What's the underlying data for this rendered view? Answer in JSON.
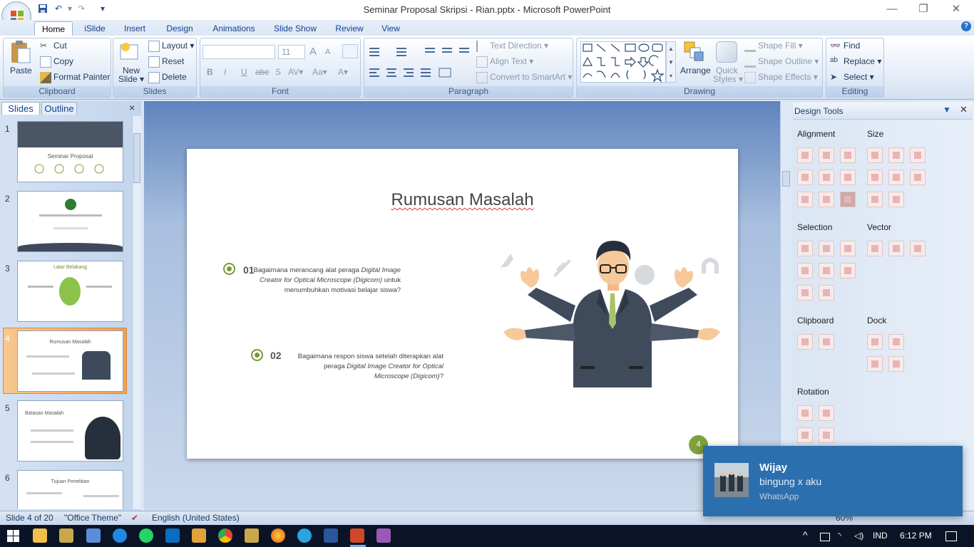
{
  "window": {
    "title": "Seminar Proposal Skripsi - Rian.pptx - Microsoft PowerPoint",
    "minimize": "—",
    "restore": "❐",
    "close": "✕"
  },
  "qat": {
    "save": "💾",
    "undo": "↶",
    "redo": "↷",
    "more": "▾"
  },
  "tabs": [
    {
      "label": "Home"
    },
    {
      "label": "iSlide"
    },
    {
      "label": "Insert"
    },
    {
      "label": "Design"
    },
    {
      "label": "Animations"
    },
    {
      "label": "Slide Show"
    },
    {
      "label": "Review"
    },
    {
      "label": "View"
    }
  ],
  "help": "?",
  "ribbon": {
    "clipboard": {
      "label": "Clipboard",
      "paste": "Paste",
      "cut": "Cut",
      "copy": "Copy",
      "format_painter": "Format Painter"
    },
    "slides": {
      "label": "Slides",
      "new_slide_1": "New",
      "new_slide_2": "Slide ▾",
      "layout": "Layout ▾",
      "reset": "Reset",
      "delete": "Delete"
    },
    "font": {
      "label": "Font",
      "size": "11",
      "bold": "B",
      "italic": "I",
      "underline": "U",
      "strike": "abc",
      "shadow": "S",
      "spacing": "AV▾",
      "case": "Aa▾",
      "color": "A▾",
      "grow": "A",
      "shrink": "A"
    },
    "paragraph": {
      "label": "Paragraph",
      "text_direction": "Text Direction ▾",
      "align_text": "Align Text ▾",
      "convert_smartart": "Convert to SmartArt ▾"
    },
    "drawing": {
      "label": "Drawing",
      "arrange": "Arrange",
      "quick_styles_1": "Quick",
      "quick_styles_2": "Styles ▾",
      "shape_fill": "Shape Fill ▾",
      "shape_outline": "Shape Outline ▾",
      "shape_effects": "Shape Effects ▾"
    },
    "editing": {
      "label": "Editing",
      "find": "Find",
      "replace": "Replace ▾",
      "select": "Select ▾"
    }
  },
  "panel_tabs": {
    "slides": "Slides",
    "outline": "Outline",
    "close": "×"
  },
  "thumbnails": [
    {
      "num": "1",
      "title": "Seminar Proposal"
    },
    {
      "num": "2",
      "title": ""
    },
    {
      "num": "3",
      "title": "Latar Belakang"
    },
    {
      "num": "4",
      "title": "Rumusan Masalah"
    },
    {
      "num": "5",
      "title": "Batasan Masalah"
    },
    {
      "num": "6",
      "title": "Tujuan Penelitian"
    }
  ],
  "slide": {
    "title": "Rumusan Masalah",
    "item1_num": "01",
    "item1_a": "Bagaimana merancang alat peraga ",
    "item1_b": "Digital Image Creator for Optical Microscope (Digicom)",
    "item1_c": " untuk menumbuhkan motivasi belajar siswa?",
    "item2_num": "02",
    "item2_a": "Bagaimana respon siswa setelah diterapkan alat peraga ",
    "item2_b": "Digital Image Creator for Optical Microscope (Digicom)",
    "item2_c": "?",
    "page_number": "4"
  },
  "design_tools": {
    "title": "Design Tools",
    "alignment": "Alignment",
    "size": "Size",
    "selection": "Selection",
    "vector": "Vector",
    "clipboard": "Clipboard",
    "dock": "Dock",
    "rotation": "Rotation"
  },
  "status": {
    "slide": "Slide 4 of 20",
    "theme": "\"Office Theme\"",
    "language": "English (United States)",
    "zoom": "60%"
  },
  "toast": {
    "sender": "Wijay",
    "message": "bingung x aku",
    "app": "WhatsApp"
  },
  "tray": {
    "lang": "IND",
    "time": "6:12 PM"
  },
  "colors": {
    "accent_green": "#7da23a",
    "ribbon_blue": "#15428b",
    "toast_blue": "#2b6fae"
  }
}
